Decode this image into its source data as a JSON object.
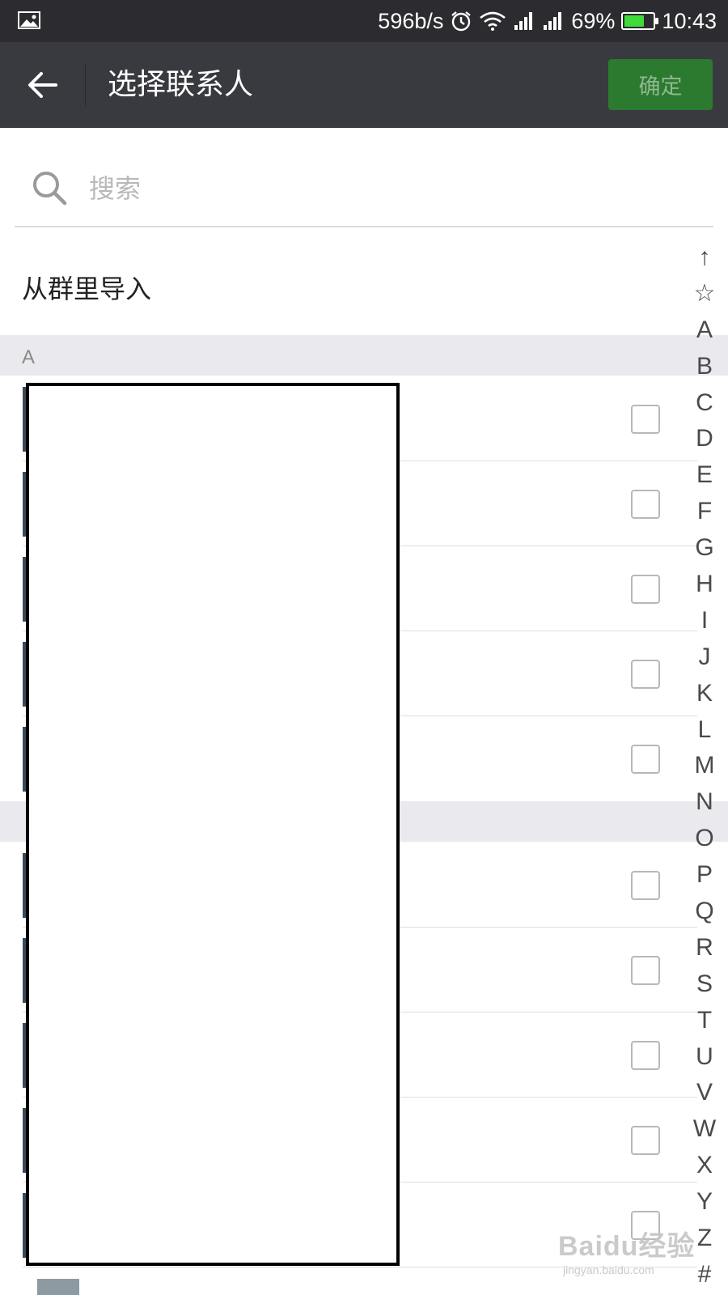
{
  "status_bar": {
    "net_speed": "596b/s",
    "battery_percent": "69%",
    "battery_level": 0.69,
    "time": "10:43",
    "icons": [
      "gallery-icon",
      "alarm-icon",
      "wifi-icon",
      "signal-icon",
      "signal-icon",
      "battery-icon"
    ]
  },
  "toolbar": {
    "title": "选择联系人",
    "confirm_label": "确定",
    "back_icon": "arrow-left-icon",
    "confirm_color": "#2b7a2f"
  },
  "search": {
    "placeholder": "搜索",
    "icon": "search-icon"
  },
  "import_label": "从群里导入",
  "sections": [
    {
      "label": "A"
    },
    {
      "label": ""
    }
  ],
  "contacts": [
    {
      "checked": false
    },
    {
      "checked": false
    },
    {
      "checked": false
    },
    {
      "checked": false
    },
    {
      "checked": false
    },
    {
      "checked": false
    },
    {
      "checked": false
    },
    {
      "checked": false
    },
    {
      "checked": false
    },
    {
      "checked": false
    }
  ],
  "index_bar": [
    "↑",
    "☆",
    "A",
    "B",
    "C",
    "D",
    "E",
    "F",
    "G",
    "H",
    "I",
    "J",
    "K",
    "L",
    "M",
    "N",
    "O",
    "P",
    "Q",
    "R",
    "S",
    "T",
    "U",
    "V",
    "W",
    "X",
    "Y",
    "Z",
    "#"
  ],
  "watermark": {
    "main": "Baidu经验",
    "sub": "jingyan.baidu.com"
  }
}
